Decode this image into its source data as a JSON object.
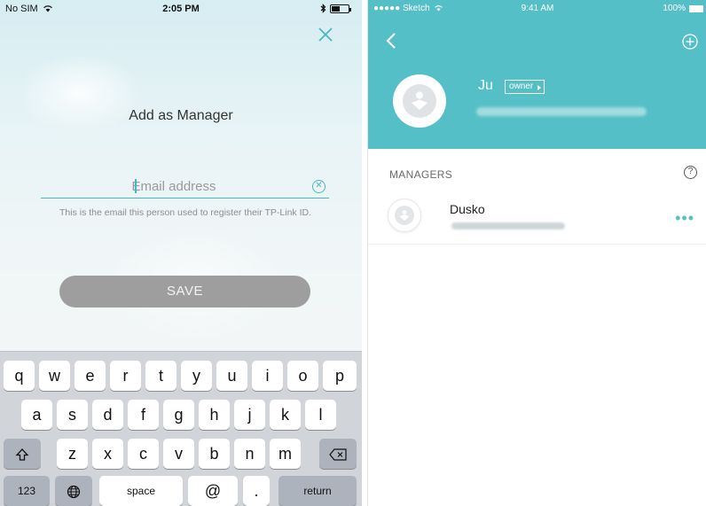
{
  "left": {
    "status": {
      "carrier": "No SIM",
      "time": "2:05 PM"
    },
    "title": "Add as Manager",
    "email": {
      "placeholder": "Email address",
      "value": ""
    },
    "hint": "This is the email this person used to register their TP-Link ID.",
    "save_label": "SAVE",
    "keyboard": {
      "row1": [
        "q",
        "w",
        "e",
        "r",
        "t",
        "y",
        "u",
        "i",
        "o",
        "p"
      ],
      "row2": [
        "a",
        "s",
        "d",
        "f",
        "g",
        "h",
        "j",
        "k",
        "l"
      ],
      "row3": [
        "z",
        "x",
        "c",
        "v",
        "b",
        "n",
        "m"
      ],
      "numbers_label": "123",
      "space_label": "space",
      "at_label": "@",
      "period_label": ".",
      "return_label": "return"
    }
  },
  "right": {
    "status": {
      "carrier": "●●●●● Sketch",
      "time": "9:41 AM",
      "battery": "100%"
    },
    "owner": {
      "name": "Ju",
      "badge": "owner"
    },
    "section_label": "MANAGERS",
    "managers": [
      {
        "name": "Dusko"
      }
    ]
  },
  "colors": {
    "accent": "#55bfc7",
    "save_button": "#9e9e9e",
    "keyboard_bg": "#d1d4d9"
  }
}
